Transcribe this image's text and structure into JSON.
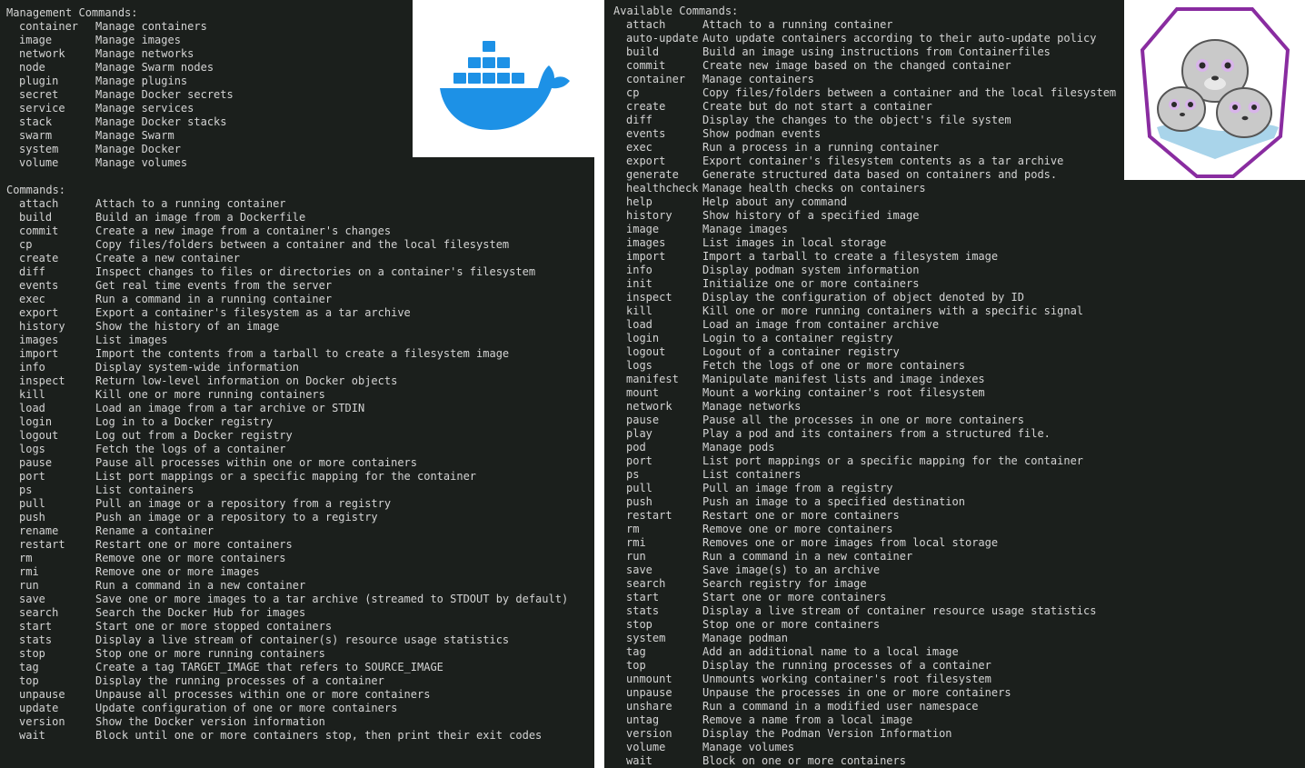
{
  "docker": {
    "management_heading": "Management Commands:",
    "management": [
      {
        "name": "container",
        "desc": "Manage containers"
      },
      {
        "name": "image",
        "desc": "Manage images"
      },
      {
        "name": "network",
        "desc": "Manage networks"
      },
      {
        "name": "node",
        "desc": "Manage Swarm nodes"
      },
      {
        "name": "plugin",
        "desc": "Manage plugins"
      },
      {
        "name": "secret",
        "desc": "Manage Docker secrets"
      },
      {
        "name": "service",
        "desc": "Manage services"
      },
      {
        "name": "stack",
        "desc": "Manage Docker stacks"
      },
      {
        "name": "swarm",
        "desc": "Manage Swarm"
      },
      {
        "name": "system",
        "desc": "Manage Docker"
      },
      {
        "name": "volume",
        "desc": "Manage volumes"
      }
    ],
    "commands_heading": "Commands:",
    "commands": [
      {
        "name": "attach",
        "desc": "Attach to a running container"
      },
      {
        "name": "build",
        "desc": "Build an image from a Dockerfile"
      },
      {
        "name": "commit",
        "desc": "Create a new image from a container's changes"
      },
      {
        "name": "cp",
        "desc": "Copy files/folders between a container and the local filesystem"
      },
      {
        "name": "create",
        "desc": "Create a new container"
      },
      {
        "name": "diff",
        "desc": "Inspect changes to files or directories on a container's filesystem"
      },
      {
        "name": "events",
        "desc": "Get real time events from the server"
      },
      {
        "name": "exec",
        "desc": "Run a command in a running container"
      },
      {
        "name": "export",
        "desc": "Export a container's filesystem as a tar archive"
      },
      {
        "name": "history",
        "desc": "Show the history of an image"
      },
      {
        "name": "images",
        "desc": "List images"
      },
      {
        "name": "import",
        "desc": "Import the contents from a tarball to create a filesystem image"
      },
      {
        "name": "info",
        "desc": "Display system-wide information"
      },
      {
        "name": "inspect",
        "desc": "Return low-level information on Docker objects"
      },
      {
        "name": "kill",
        "desc": "Kill one or more running containers"
      },
      {
        "name": "load",
        "desc": "Load an image from a tar archive or STDIN"
      },
      {
        "name": "login",
        "desc": "Log in to a Docker registry"
      },
      {
        "name": "logout",
        "desc": "Log out from a Docker registry"
      },
      {
        "name": "logs",
        "desc": "Fetch the logs of a container"
      },
      {
        "name": "pause",
        "desc": "Pause all processes within one or more containers"
      },
      {
        "name": "port",
        "desc": "List port mappings or a specific mapping for the container"
      },
      {
        "name": "ps",
        "desc": "List containers"
      },
      {
        "name": "pull",
        "desc": "Pull an image or a repository from a registry"
      },
      {
        "name": "push",
        "desc": "Push an image or a repository to a registry"
      },
      {
        "name": "rename",
        "desc": "Rename a container"
      },
      {
        "name": "restart",
        "desc": "Restart one or more containers"
      },
      {
        "name": "rm",
        "desc": "Remove one or more containers"
      },
      {
        "name": "rmi",
        "desc": "Remove one or more images"
      },
      {
        "name": "run",
        "desc": "Run a command in a new container"
      },
      {
        "name": "save",
        "desc": "Save one or more images to a tar archive (streamed to STDOUT by default)"
      },
      {
        "name": "search",
        "desc": "Search the Docker Hub for images"
      },
      {
        "name": "start",
        "desc": "Start one or more stopped containers"
      },
      {
        "name": "stats",
        "desc": "Display a live stream of container(s) resource usage statistics"
      },
      {
        "name": "stop",
        "desc": "Stop one or more running containers"
      },
      {
        "name": "tag",
        "desc": "Create a tag TARGET_IMAGE that refers to SOURCE_IMAGE"
      },
      {
        "name": "top",
        "desc": "Display the running processes of a container"
      },
      {
        "name": "unpause",
        "desc": "Unpause all processes within one or more containers"
      },
      {
        "name": "update",
        "desc": "Update configuration of one or more containers"
      },
      {
        "name": "version",
        "desc": "Show the Docker version information"
      },
      {
        "name": "wait",
        "desc": "Block until one or more containers stop, then print their exit codes"
      }
    ],
    "logo_icon": "docker-whale-icon",
    "logo_color": "#1d91e6"
  },
  "podman": {
    "commands_heading": "Available Commands:",
    "commands": [
      {
        "name": "attach",
        "desc": "Attach to a running container"
      },
      {
        "name": "auto-update",
        "desc": "Auto update containers according to their auto-update policy"
      },
      {
        "name": "build",
        "desc": "Build an image using instructions from Containerfiles"
      },
      {
        "name": "commit",
        "desc": "Create new image based on the changed container"
      },
      {
        "name": "container",
        "desc": "Manage containers"
      },
      {
        "name": "cp",
        "desc": "Copy files/folders between a container and the local filesystem"
      },
      {
        "name": "create",
        "desc": "Create but do not start a container"
      },
      {
        "name": "diff",
        "desc": "Display the changes to the object's file system"
      },
      {
        "name": "events",
        "desc": "Show podman events"
      },
      {
        "name": "exec",
        "desc": "Run a process in a running container"
      },
      {
        "name": "export",
        "desc": "Export container's filesystem contents as a tar archive"
      },
      {
        "name": "generate",
        "desc": "Generate structured data based on containers and pods."
      },
      {
        "name": "healthcheck",
        "desc": "Manage health checks on containers"
      },
      {
        "name": "help",
        "desc": "Help about any command"
      },
      {
        "name": "history",
        "desc": "Show history of a specified image"
      },
      {
        "name": "image",
        "desc": "Manage images"
      },
      {
        "name": "images",
        "desc": "List images in local storage"
      },
      {
        "name": "import",
        "desc": "Import a tarball to create a filesystem image"
      },
      {
        "name": "info",
        "desc": "Display podman system information"
      },
      {
        "name": "init",
        "desc": "Initialize one or more containers"
      },
      {
        "name": "inspect",
        "desc": "Display the configuration of object denoted by ID"
      },
      {
        "name": "kill",
        "desc": "Kill one or more running containers with a specific signal"
      },
      {
        "name": "load",
        "desc": "Load an image from container archive"
      },
      {
        "name": "login",
        "desc": "Login to a container registry"
      },
      {
        "name": "logout",
        "desc": "Logout of a container registry"
      },
      {
        "name": "logs",
        "desc": "Fetch the logs of one or more containers"
      },
      {
        "name": "manifest",
        "desc": "Manipulate manifest lists and image indexes"
      },
      {
        "name": "mount",
        "desc": "Mount a working container's root filesystem"
      },
      {
        "name": "network",
        "desc": "Manage networks"
      },
      {
        "name": "pause",
        "desc": "Pause all the processes in one or more containers"
      },
      {
        "name": "play",
        "desc": "Play a pod and its containers from a structured file."
      },
      {
        "name": "pod",
        "desc": "Manage pods"
      },
      {
        "name": "port",
        "desc": "List port mappings or a specific mapping for the container"
      },
      {
        "name": "ps",
        "desc": "List containers"
      },
      {
        "name": "pull",
        "desc": "Pull an image from a registry"
      },
      {
        "name": "push",
        "desc": "Push an image to a specified destination"
      },
      {
        "name": "restart",
        "desc": "Restart one or more containers"
      },
      {
        "name": "rm",
        "desc": "Remove one or more containers"
      },
      {
        "name": "rmi",
        "desc": "Removes one or more images from local storage"
      },
      {
        "name": "run",
        "desc": "Run a command in a new container"
      },
      {
        "name": "save",
        "desc": "Save image(s) to an archive"
      },
      {
        "name": "search",
        "desc": "Search registry for image"
      },
      {
        "name": "start",
        "desc": "Start one or more containers"
      },
      {
        "name": "stats",
        "desc": "Display a live stream of container resource usage statistics"
      },
      {
        "name": "stop",
        "desc": "Stop one or more containers"
      },
      {
        "name": "system",
        "desc": "Manage podman"
      },
      {
        "name": "tag",
        "desc": "Add an additional name to a local image"
      },
      {
        "name": "top",
        "desc": "Display the running processes of a container"
      },
      {
        "name": "unmount",
        "desc": "Unmounts working container's root filesystem"
      },
      {
        "name": "unpause",
        "desc": "Unpause the processes in one or more containers"
      },
      {
        "name": "unshare",
        "desc": "Run a command in a modified user namespace"
      },
      {
        "name": "untag",
        "desc": "Remove a name from a local image"
      },
      {
        "name": "version",
        "desc": "Display the Podman Version Information"
      },
      {
        "name": "volume",
        "desc": "Manage volumes"
      },
      {
        "name": "wait",
        "desc": "Block on one or more containers"
      }
    ],
    "logo_icon": "podman-seals-icon",
    "logo_color": "#892ca0"
  }
}
